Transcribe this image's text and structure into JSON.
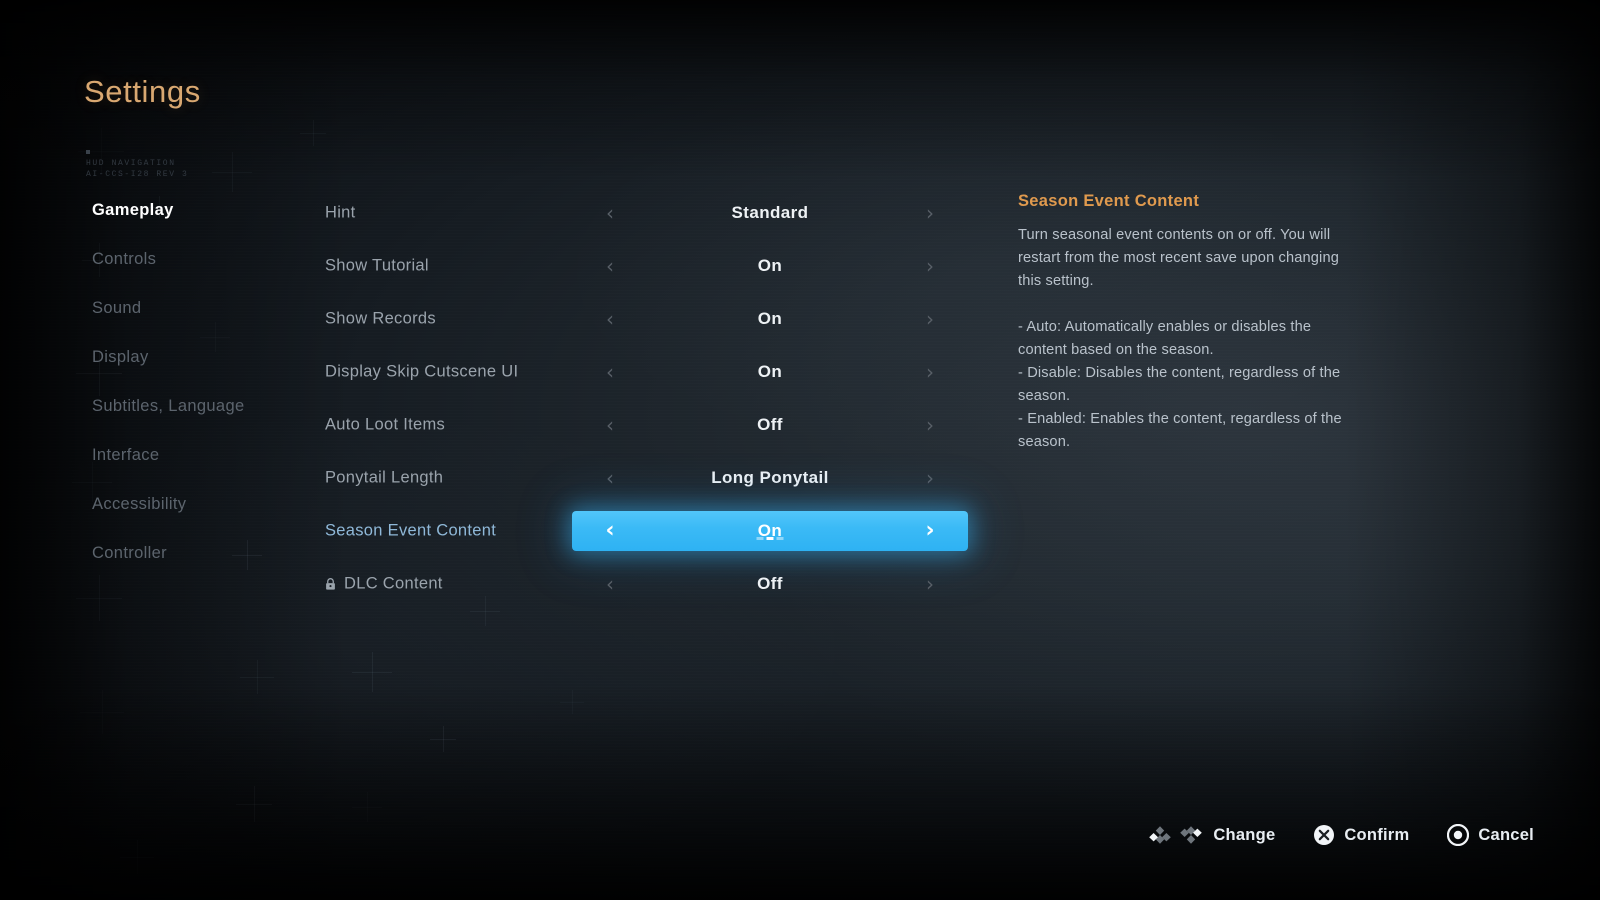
{
  "header": {
    "title": "Settings",
    "deco_code": "HUD NAVIGATION\nAI-CCS-I28 REV 3"
  },
  "colors": {
    "title": "#d9a871",
    "accent_orange": "#e09a4e",
    "highlight_blue": "#3bbaf6",
    "selected_label": "#8fb8d8",
    "label": "#9aa3ac",
    "value": "#eef2f5",
    "nav_inactive": "#5c646d",
    "nav_active": "#ffffff"
  },
  "sidebar": {
    "items": [
      {
        "label": "Gameplay",
        "active": true
      },
      {
        "label": "Controls",
        "active": false
      },
      {
        "label": "Sound",
        "active": false
      },
      {
        "label": "Display",
        "active": false
      },
      {
        "label": "Subtitles, Language",
        "active": false
      },
      {
        "label": "Interface",
        "active": false
      },
      {
        "label": "Accessibility",
        "active": false
      },
      {
        "label": "Controller",
        "active": false
      }
    ]
  },
  "settings": {
    "rows": [
      {
        "label": "Hint",
        "value": "Standard",
        "selected": false,
        "locked": false
      },
      {
        "label": "Show Tutorial",
        "value": "On",
        "selected": false,
        "locked": false
      },
      {
        "label": "Show Records",
        "value": "On",
        "selected": false,
        "locked": false
      },
      {
        "label": "Display Skip Cutscene UI",
        "value": "On",
        "selected": false,
        "locked": false
      },
      {
        "label": "Auto Loot Items",
        "value": "Off",
        "selected": false,
        "locked": false
      },
      {
        "label": "Ponytail Length",
        "value": "Long Ponytail",
        "selected": false,
        "locked": false
      },
      {
        "label": "Season Event Content",
        "value": "On",
        "selected": true,
        "locked": false,
        "segments": 3,
        "segment_active": 2
      },
      {
        "label": "DLC Content",
        "value": "Off",
        "selected": false,
        "locked": true
      }
    ],
    "prev_chevron": "‹",
    "next_chevron": "›"
  },
  "description": {
    "title": "Season Event Content",
    "body": "Turn seasonal event contents on or off. You will restart from the most recent save upon changing this setting.",
    "bullets": [
      "- Auto: Automatically enables or disables the content based on the season.",
      "- Disable: Disables the content, regardless of the season.",
      "- Enabled: Enables the content, regardless of the season."
    ]
  },
  "button_prompts": [
    {
      "label": "Change",
      "icon": "dpad-left-right-icon"
    },
    {
      "label": "Confirm",
      "icon": "cross-button-icon"
    },
    {
      "label": "Cancel",
      "icon": "circle-button-icon"
    }
  ]
}
